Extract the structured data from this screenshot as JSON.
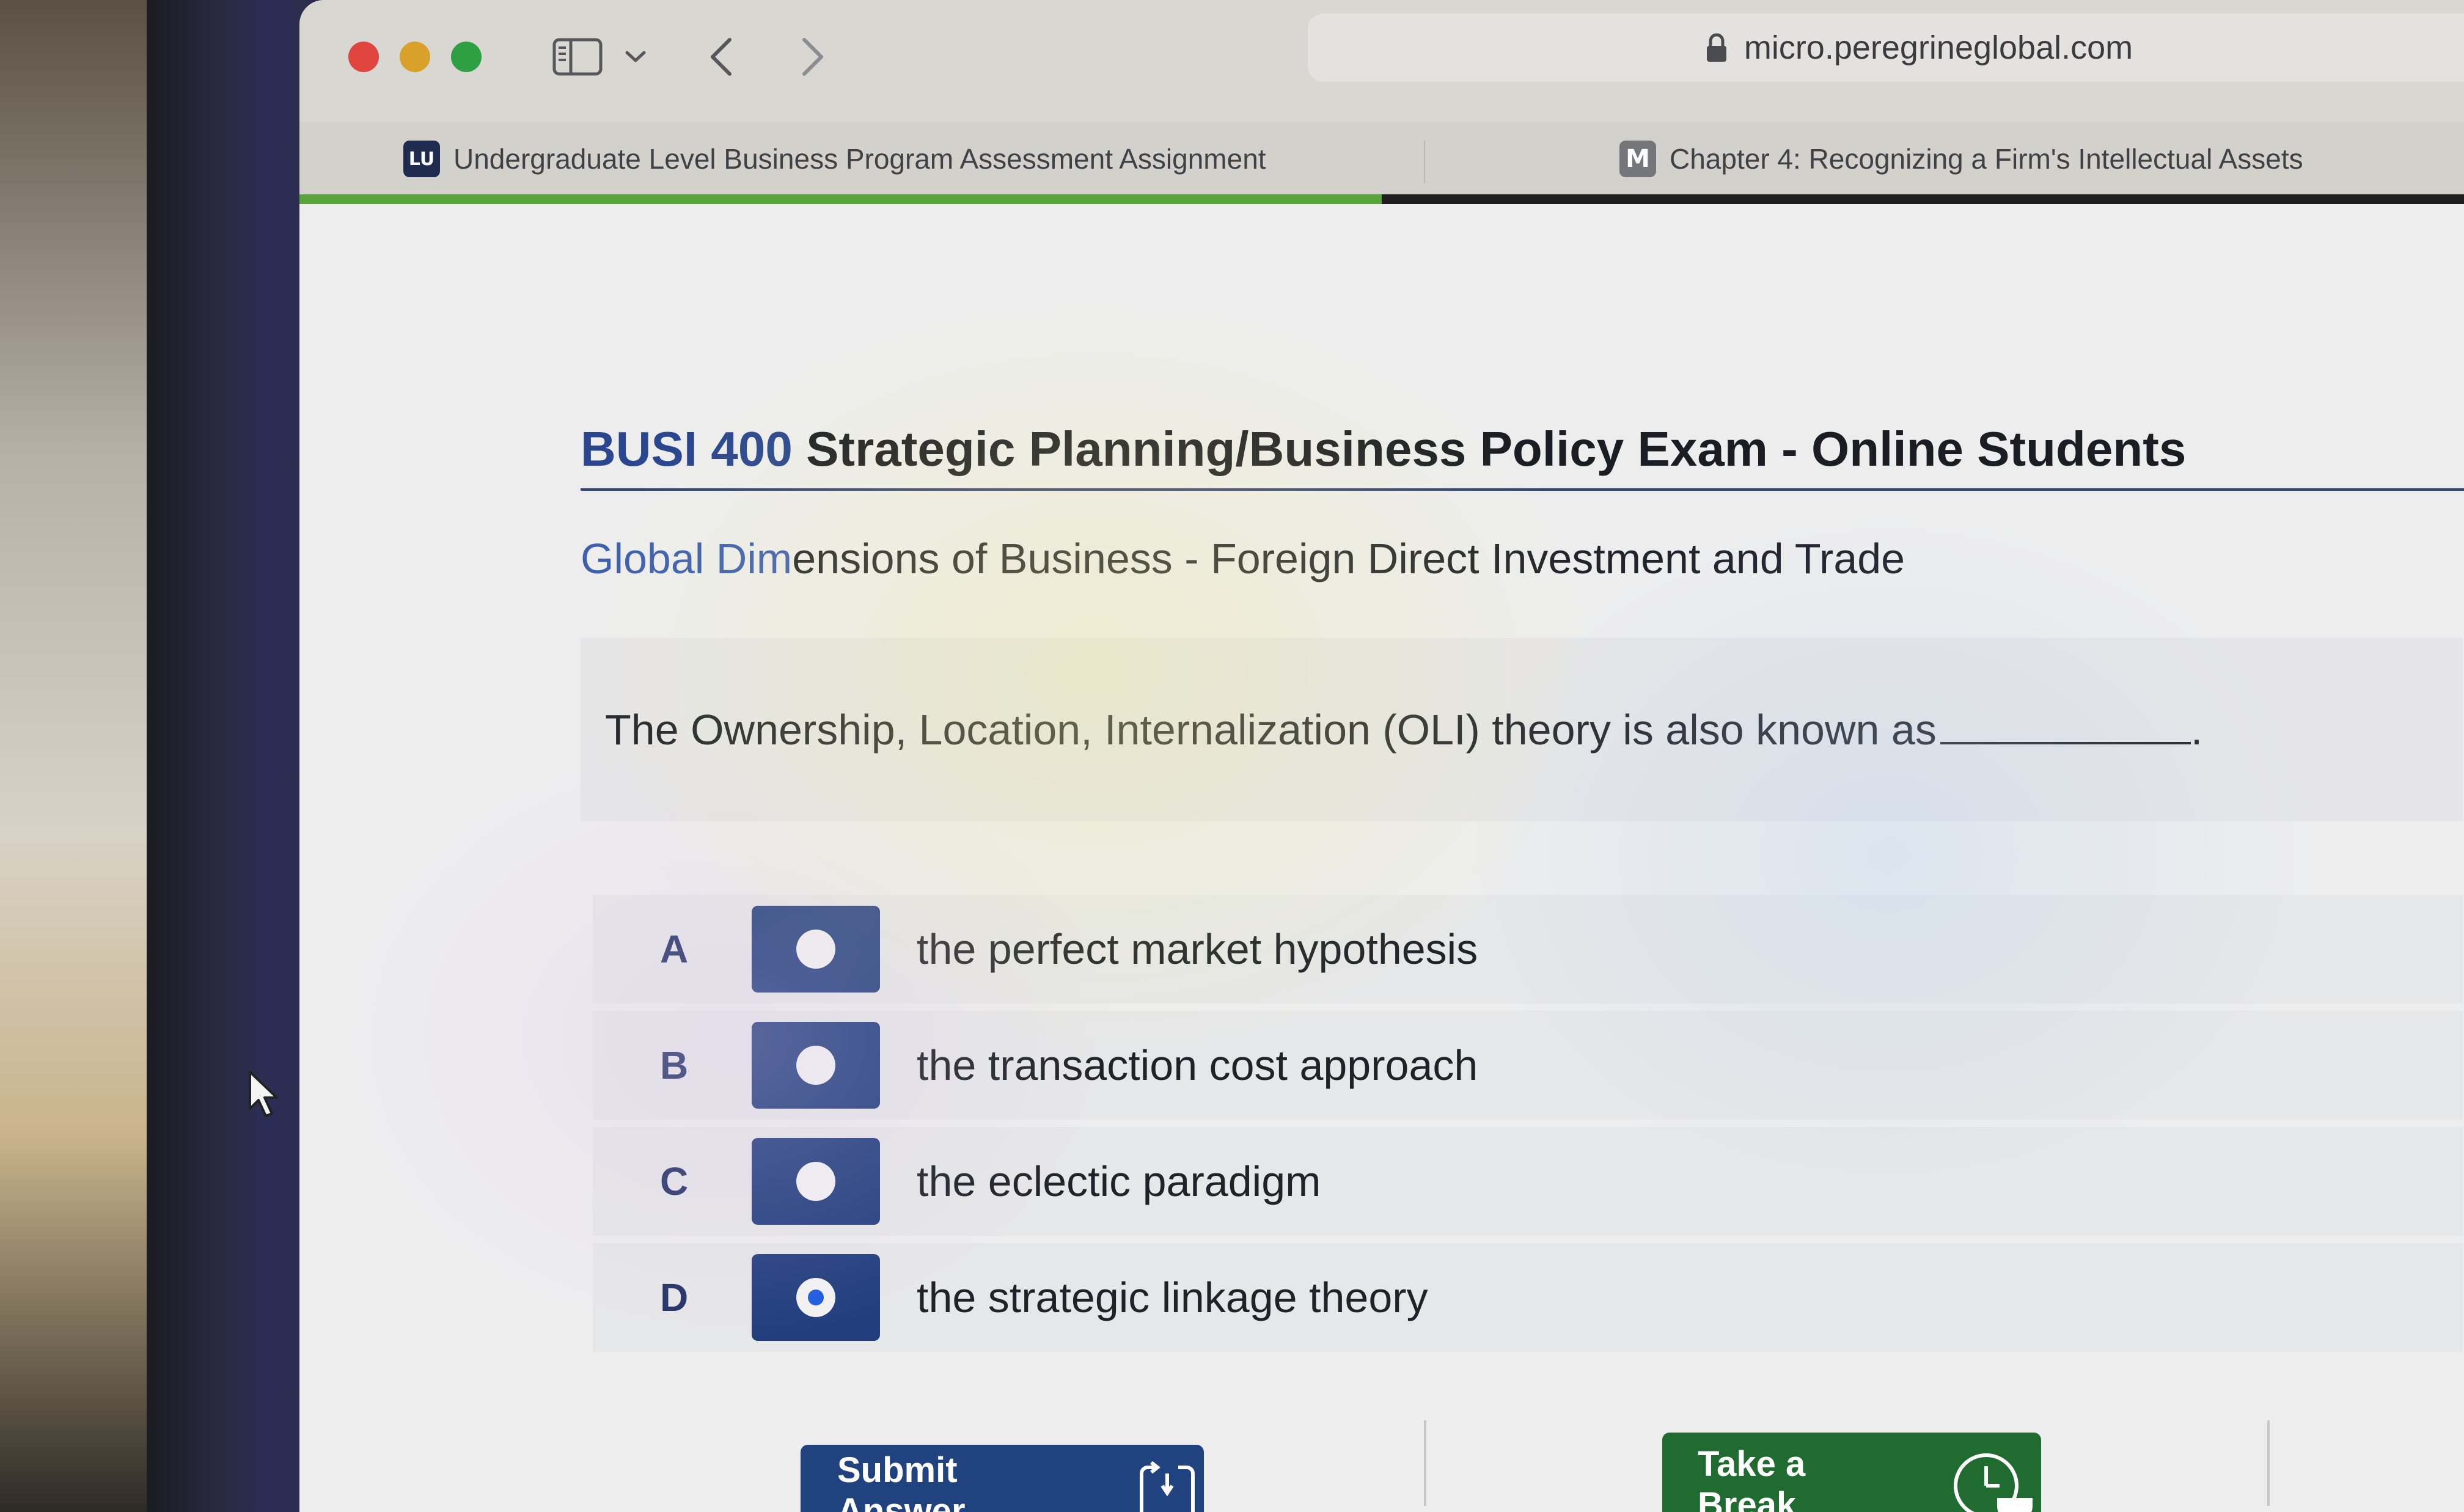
{
  "browser": {
    "url": "micro.peregrineglobal.com",
    "tabs": [
      {
        "label": "Undergraduate Level Business Program Assessment Assignment",
        "favicon": "lu-logo-icon",
        "active": true
      },
      {
        "label": "Chapter 4: Recognizing a Firm's Intellectual Assets",
        "favicon_text": "M",
        "active": false
      }
    ],
    "load_progress": 0.5
  },
  "exam": {
    "code": "BUSI 400",
    "title_rest": " Strategic Planning/Business Policy Exam - Online Students",
    "section_highlight": "Global Dim",
    "section_rest": "ensions of Business - Foreign Direct Investment and Trade",
    "question": "The Ownership, Location, Internalization (OLI) theory is also known as",
    "question_end": "."
  },
  "options": [
    {
      "letter": "A",
      "text": "the perfect market hypothesis",
      "selected": false
    },
    {
      "letter": "B",
      "text": "the transaction cost approach",
      "selected": false
    },
    {
      "letter": "C",
      "text": "the eclectic paradigm",
      "selected": false
    },
    {
      "letter": "D",
      "text": "the strategic linkage theory",
      "selected": true
    }
  ],
  "actions": {
    "submit_label": "Submit Answer",
    "break_label": "Take a Break"
  },
  "colors": {
    "primary_blue": "#223e7d",
    "break_green": "#1f6b30",
    "selected_dot": "#1f5be0",
    "progress_green": "#5aa33c"
  }
}
